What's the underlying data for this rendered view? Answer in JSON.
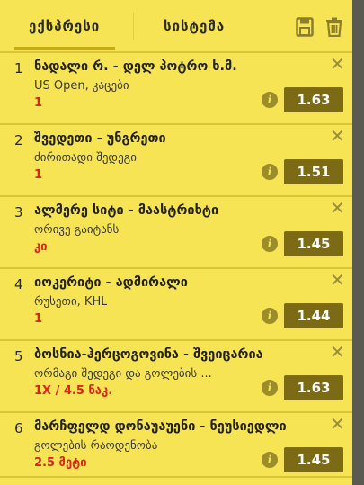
{
  "tabs": {
    "express_label": "ექსპრესი",
    "system_label": "სისტემა"
  },
  "icons": {
    "save": "save-icon",
    "delete": "trash-icon",
    "close": "close-icon",
    "info": "info-icon"
  },
  "colors": {
    "panel_bg": "#f7e454",
    "odds_bg": "#7c6a14",
    "pick_text": "#d6261d",
    "tab_underline": "#c4ac14"
  },
  "bets": [
    {
      "index": "1",
      "title": "ნადალი რ. - დელ პოტრო ხ.მ.",
      "market": "US Open, კაცები",
      "pick": "1",
      "odds": "1.63",
      "close": "✕",
      "info": "i"
    },
    {
      "index": "2",
      "title": "შვედეთი - უნგრეთი",
      "market": "ძირითადი შედეგი",
      "pick": "1",
      "odds": "1.51",
      "close": "✕",
      "info": "i"
    },
    {
      "index": "3",
      "title": "ალმერე სიტი - მაასტრიხტი",
      "market": "ორივე გაიტანს",
      "pick": "კი",
      "odds": "1.45",
      "close": "✕",
      "info": "i"
    },
    {
      "index": "4",
      "title": "იოკერიტი - ადმირალი",
      "market": "რუსეთი, KHL",
      "pick": "1",
      "odds": "1.44",
      "close": "✕",
      "info": "i"
    },
    {
      "index": "5",
      "title": "ბოსნია-ჰერცოგოვინა - შვეიცარია",
      "market": "ორმაგი შედეგი და გოლების ...",
      "pick": "1X / 4.5 ნაკ.",
      "odds": "1.63",
      "close": "✕",
      "info": "i"
    },
    {
      "index": "6",
      "title": "მარჩფელდ დონაუაუენი - ნეუსიედლი",
      "market": "გოლების რაოდენობა",
      "pick": "2.5 მეტი",
      "odds": "1.45",
      "close": "✕",
      "info": "i"
    }
  ]
}
